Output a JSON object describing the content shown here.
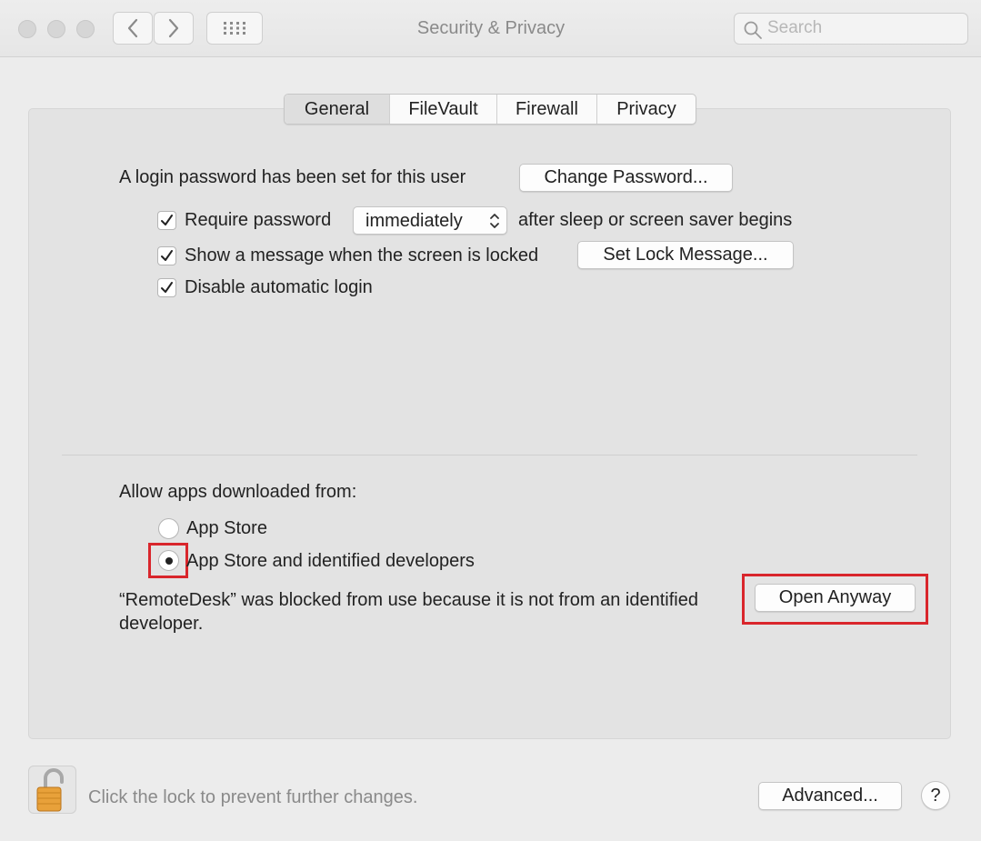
{
  "window": {
    "title": "Security & Privacy",
    "search_placeholder": "Search"
  },
  "tabs": [
    {
      "label": "General",
      "active": true
    },
    {
      "label": "FileVault",
      "active": false
    },
    {
      "label": "Firewall",
      "active": false
    },
    {
      "label": "Privacy",
      "active": false
    }
  ],
  "general": {
    "login_text": "A login password has been set for this user",
    "change_password_button": "Change Password...",
    "require_password": {
      "label": "Require password",
      "checked": true
    },
    "require_password_select": "immediately",
    "after_sleep_text": "after sleep or screen saver begins",
    "show_message": {
      "label": "Show a message when the screen is locked",
      "checked": true
    },
    "set_lock_message_button": "Set Lock Message...",
    "disable_auto_login": {
      "label": "Disable automatic login",
      "checked": true
    }
  },
  "downloads": {
    "heading": "Allow apps downloaded from:",
    "options": [
      {
        "label": "App Store",
        "selected": false
      },
      {
        "label": "App Store and identified developers",
        "selected": true
      }
    ],
    "blocked_message": "“RemoteDesk” was blocked from use because it is not from an identified developer.",
    "open_anyway_button": "Open Anyway"
  },
  "footer": {
    "lock_text": "Click the lock to prevent further changes.",
    "advanced_button": "Advanced...",
    "help_button": "?"
  },
  "colors": {
    "highlight": "#d9262c",
    "lock": "#e8a13a"
  },
  "icons": {
    "back": "chevron-left-icon",
    "forward": "chevron-right-icon",
    "grid": "grid-icon",
    "search": "search-icon",
    "lock": "unlocked-padlock-icon"
  }
}
